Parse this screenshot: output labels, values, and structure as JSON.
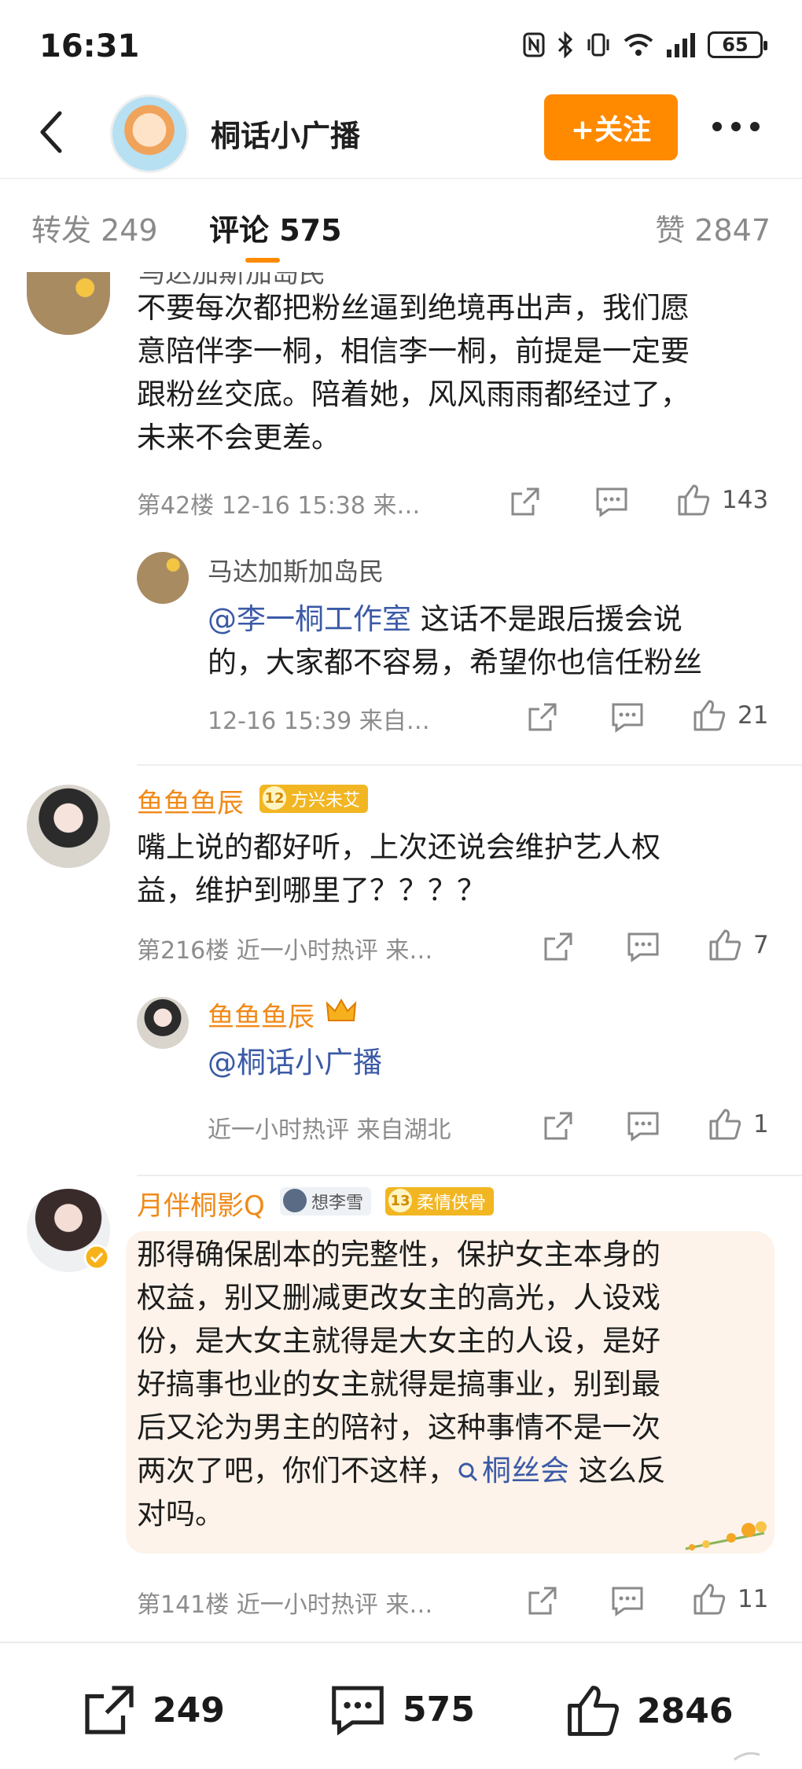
{
  "status_bar": {
    "time": "16:31",
    "battery": "65"
  },
  "header": {
    "account_name": "桐话小广播",
    "follow_label": "+关注"
  },
  "tabs": {
    "repost": "转发 249",
    "comment": "评论 575",
    "like": "赞 2847"
  },
  "partial_top": {
    "name_cut": "马达加斯加岛民"
  },
  "comments": [
    {
      "name": "马达加斯加岛民",
      "lines": [
        "不要每次都把粉丝逼到绝境再出声，我们愿",
        "意陪伴李一桐，相信李一桐，前提是一定要",
        "跟粉丝交底。陪着她，风风雨雨都经过了，",
        "未来不会更差。"
      ],
      "meta": "第42楼  12-16 15:38  来…",
      "likes": "143",
      "reply": {
        "name": "马达加斯加岛民",
        "mention": "@李一桐工作室",
        "text_line1": " 这话不是跟后援会说",
        "text_line2": "的，大家都不容易，希望你也信任粉丝",
        "meta": "12-16 15:39  来自…",
        "likes": "21"
      }
    },
    {
      "name": "鱼鱼鱼辰",
      "badge_num": "12",
      "badge": "方兴未艾",
      "lines": [
        "嘴上说的都好听，上次还说会维护艺人权",
        "益，维护到哪里了？？？？"
      ],
      "meta": "第216楼  近一小时热评  来…",
      "likes": "7",
      "reply": {
        "name": "鱼鱼鱼辰",
        "mention": "@桐话小广播",
        "meta": "近一小时热评  来自湖北",
        "likes": "1"
      }
    },
    {
      "name": "月伴桐影Q",
      "badge_group": "想李雪",
      "badge_num": "13",
      "badge": "柔情侠骨",
      "lines": [
        "那得确保剧本的完整性，保护女主本身的",
        "权益，别又删减更改女主的高光，人设戏",
        "份，是大女主就得是大女主的人设，是好",
        "好搞事也业的女主就得是搞事业，别到最",
        "后又沦为男主的陪衬，这种事情不是一次"
      ],
      "line6_before": "两次了吧，你们不这样，",
      "topic": "桐丝会",
      "line6_after": " 这么反",
      "line7": "对吗。",
      "meta": "第141楼  近一小时热评  来…",
      "likes": "11"
    }
  ],
  "bottom_bar": {
    "reposts": "249",
    "comments": "575",
    "likes": "2846"
  },
  "colors": {
    "accent": "#ff8a00",
    "name_orange": "#f08a18",
    "mention_blue": "#3b5aa6"
  }
}
